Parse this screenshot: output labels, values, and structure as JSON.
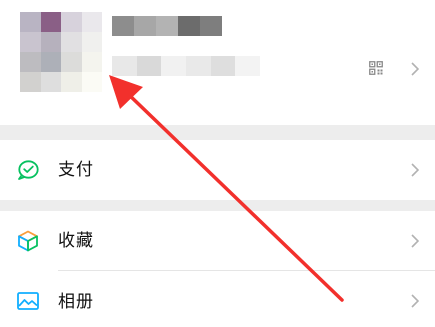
{
  "profile": {
    "avatar_colors": [
      "#b9b4c3",
      "#8a5f86",
      "#d7d2dc",
      "#eae8ec",
      "#c9c4cf",
      "#b6b1bd",
      "#e1e0e2",
      "#f0f0ee",
      "#bdbcc0",
      "#adb0b8",
      "#dcdcda",
      "#f4f4ee",
      "#d2d1cf",
      "#dedede",
      "#efefe8",
      "#fbfbf5"
    ],
    "name_colors": [
      "#8d8d8d",
      "#a7a7a7",
      "#b3b3b3",
      "#6c6c6c",
      "#7e7e7e"
    ],
    "id_colors": [
      "#e8e8e8",
      "#d9d9d9",
      "#f1f1f1",
      "#e9e9e9",
      "#dedede",
      "#f3f3f3"
    ],
    "qr_icon": "qr-code-icon",
    "chevron_icon": "chevron-right-icon"
  },
  "menu": [
    {
      "label": "支付",
      "icon": "pay-icon",
      "icon_color": "#07c160"
    },
    {
      "label": "收藏",
      "icon": "favorites-cube-icon",
      "icon_colors": [
        "#fa9d3b",
        "#10aeff",
        "#07c160"
      ]
    },
    {
      "label": "相册",
      "icon": "album-icon",
      "icon_color": "#10aeff"
    }
  ],
  "annotation": {
    "arrow_color": "#f2302c"
  }
}
